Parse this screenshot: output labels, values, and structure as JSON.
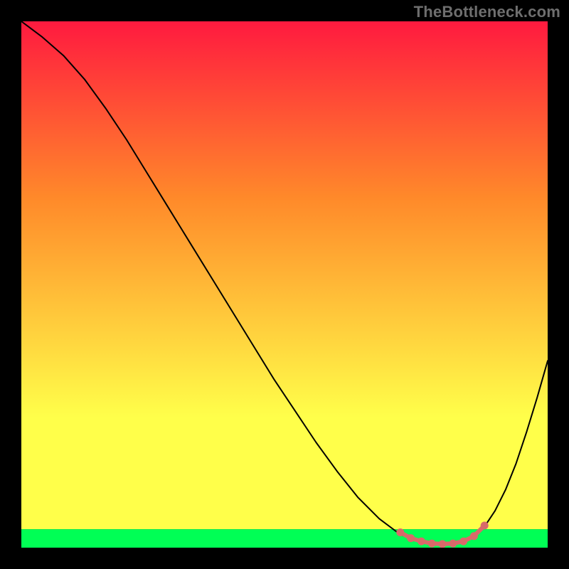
{
  "watermark": "TheBottleneck.com",
  "chart_data": {
    "type": "line",
    "title": "",
    "xlabel": "",
    "ylabel": "",
    "xlim": [
      0,
      100
    ],
    "ylim": [
      0,
      100
    ],
    "grid": false,
    "legend": false,
    "background_gradient": {
      "top": "#ff1a3f",
      "mid_upper": "#ff8a2a",
      "mid_lower": "#ffff4a",
      "bottom_band": "#00ff55"
    },
    "curve_color": "#000000",
    "curve_width": 2,
    "marker_color": "#d86a6a",
    "marker_radius": 5.5,
    "series": [
      {
        "name": "bottleneck-curve",
        "x": [
          0,
          4,
          8,
          12,
          16,
          20,
          24,
          28,
          32,
          36,
          40,
          44,
          48,
          52,
          56,
          60,
          64,
          68,
          72,
          76,
          80,
          82,
          84,
          86,
          88,
          90,
          92,
          94,
          96,
          98,
          100
        ],
        "y": [
          100,
          97,
          93.5,
          89,
          83.5,
          77.5,
          71,
          64.5,
          58,
          51.5,
          45,
          38.5,
          32,
          26,
          20,
          14.5,
          9.5,
          5.5,
          2.5,
          1,
          0.5,
          0.6,
          1.0,
          2.0,
          4.0,
          7.0,
          11.0,
          16.0,
          22.0,
          28.5,
          35.5
        ]
      }
    ],
    "markers": {
      "x": [
        72,
        74,
        76,
        78,
        80,
        82,
        84,
        86,
        88
      ],
      "y": [
        2.9,
        1.8,
        1.2,
        0.8,
        0.7,
        0.8,
        1.2,
        2.2,
        4.2
      ]
    },
    "bottom_green_band_fraction": 0.035
  }
}
